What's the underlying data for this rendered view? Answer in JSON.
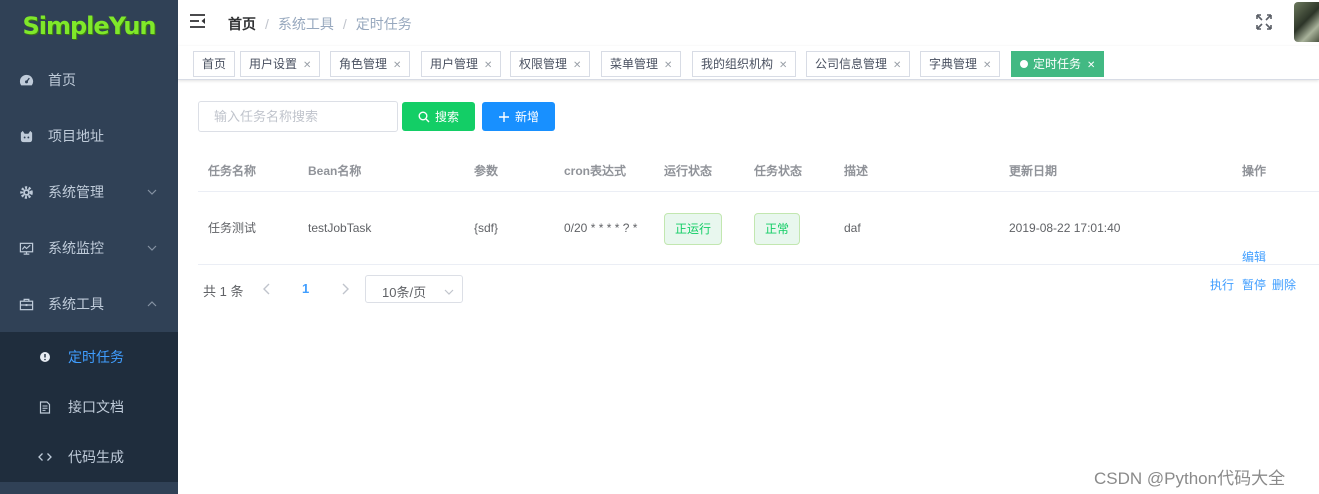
{
  "sidebar": {
    "logo": "SimpleYun",
    "items": [
      {
        "label": "首页"
      },
      {
        "label": "项目地址"
      },
      {
        "label": "系统管理"
      },
      {
        "label": "系统监控"
      },
      {
        "label": "系统工具"
      }
    ],
    "sub_items": [
      {
        "label": "定时任务",
        "active": true
      },
      {
        "label": "接口文档"
      },
      {
        "label": "代码生成"
      }
    ]
  },
  "navbar": {
    "breadcrumb": [
      "首页",
      "系统工具",
      "定时任务"
    ],
    "separator": "/"
  },
  "tags": [
    {
      "label": "首页",
      "closable": false
    },
    {
      "label": "用户设置",
      "closable": true
    },
    {
      "label": "角色管理",
      "closable": true
    },
    {
      "label": "用户管理",
      "closable": true
    },
    {
      "label": "权限管理",
      "closable": true
    },
    {
      "label": "菜单管理",
      "closable": true
    },
    {
      "label": "我的组织机构",
      "closable": true
    },
    {
      "label": "公司信息管理",
      "closable": true
    },
    {
      "label": "字典管理",
      "closable": true
    },
    {
      "label": "定时任务",
      "closable": true,
      "active": true
    }
  ],
  "toolbar": {
    "search_placeholder": "输入任务名称搜索",
    "search_button": "搜索",
    "add_button": "新增"
  },
  "table": {
    "headers": [
      "任务名称",
      "Bean名称",
      "参数",
      "cron表达式",
      "运行状态",
      "任务状态",
      "描述",
      "更新日期",
      "操作"
    ],
    "rows": [
      {
        "name": "任务测试",
        "bean": "testJobTask",
        "params": "{sdf}",
        "cron": "0/20 * * * * ? *",
        "run_status": "正运行",
        "task_status": "正常",
        "desc": "daf",
        "updated": "2019-08-22 17:01:40",
        "actions": {
          "edit": "编辑",
          "execute": "执行",
          "pause": "暂停",
          "delete": "删除"
        }
      }
    ]
  },
  "pagination": {
    "total_text": "共 1 条",
    "current_page": "1",
    "page_size": "10条/页"
  },
  "watermark": "CSDN @Python代码大全",
  "colors": {
    "sidebar_bg": "#304156",
    "submenu_bg": "#1f2d3d",
    "active_tag": "#42b983",
    "search_btn": "#13ce66",
    "add_btn": "#1890ff",
    "link": "#409eff",
    "logo": "#7fe82a"
  }
}
